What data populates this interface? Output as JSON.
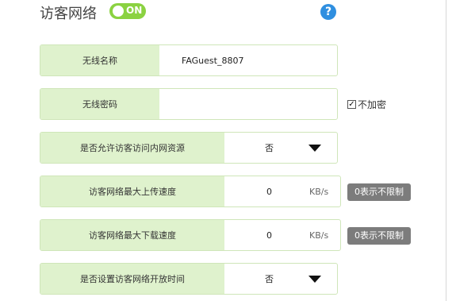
{
  "header": {
    "title": "访客网络",
    "toggle_label": "ON",
    "help_glyph": "?"
  },
  "fields": {
    "ssid": {
      "label": "无线名称",
      "value": "FAGuest_8807"
    },
    "password": {
      "label": "无线密码",
      "value": "",
      "no_encrypt_label": "不加密",
      "no_encrypt_checked": true
    },
    "intranet": {
      "label": "是否允许访客访问内网资源",
      "value": "否"
    },
    "upload": {
      "label": "访客网络最大上传速度",
      "value": "0",
      "unit": "KB/s",
      "hint": "0表示不限制"
    },
    "download": {
      "label": "访客网络最大下载速度",
      "value": "0",
      "unit": "KB/s",
      "hint": "0表示不限制"
    },
    "schedule": {
      "label": "是否设置访客网络开放时间",
      "value": "否"
    }
  },
  "colors": {
    "toggle_on": "#8bd241",
    "label_bg": "#dff2cd",
    "help_icon": "#2f8fe0",
    "badge_bg": "#7c7c7c"
  }
}
